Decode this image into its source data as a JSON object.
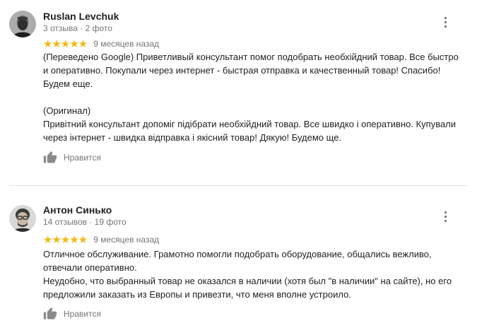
{
  "reviews": [
    {
      "author": "Ruslan Levchuk",
      "stats": "3 отзыва · 2 фото",
      "rating": 5,
      "stars": "★★★★★",
      "date": "9 месяцев назад",
      "paragraphs": [
        "(Переведено Google) Приветливый консультант помог подобрать необхійдний товар. Все быстро и оперативно. Покупали через интернет - быстрая отправка и качественный товар! Спасибо! Будем еще.",
        "",
        "(Оригинал)",
        "Привітний консультант допоміг підібрати необхійдний товар. Все швидко і оперативно. Купували через інтернет - швидка відправка і якісний товар! Дякую! Будемо ще."
      ],
      "like_label": "Нравится"
    },
    {
      "author": "Антон Синько",
      "stats": "14 отзывов · 19 фото",
      "rating": 5,
      "stars": "★★★★★",
      "date": "9 месяцев назад",
      "paragraphs": [
        "Отличное обслуживание. Грамотно помогли подобрать оборудование, общались вежливо, отвечали оперативно.",
        "Неудобно, что выбранный товар не оказался в наличии (хотя был \"в наличии\" на сайте), но его предложили заказать из Европы и привезти, что меня вполне устроило."
      ],
      "like_label": "Нравится"
    }
  ],
  "colors": {
    "star": "#f7b80b",
    "muted_text": "#767676",
    "body_text": "#222222",
    "divider": "#e4e4e4"
  },
  "icons": {
    "like": "thumb-up-icon",
    "more": "more-vert-icon",
    "avatar": "profile-photo"
  }
}
